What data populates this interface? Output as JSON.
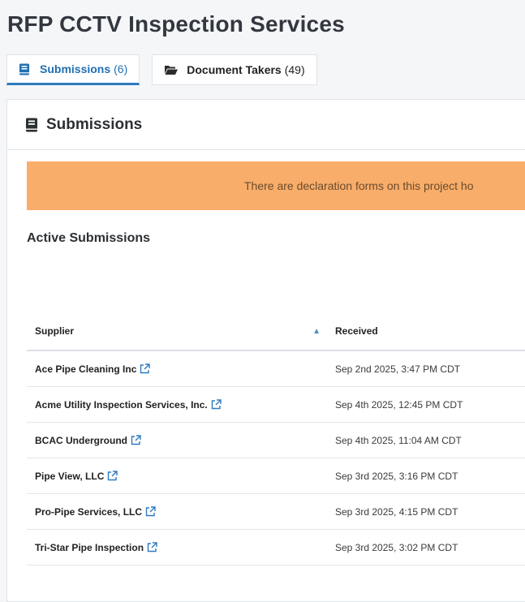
{
  "page": {
    "title": "RFP CCTV Inspection Services"
  },
  "tabs": [
    {
      "label": "Submissions",
      "count": "(6)",
      "icon": "book-icon",
      "active": true
    },
    {
      "label": "Document Takers",
      "count": "(49)",
      "icon": "folder-open-icon",
      "active": false
    }
  ],
  "panel": {
    "title": "Submissions",
    "icon": "book-icon",
    "alert": "There are declaration forms on this project ho",
    "section_heading": "Active Submissions"
  },
  "table": {
    "columns": [
      "Supplier",
      "Received"
    ],
    "sort_indicator": "▲",
    "rows": [
      {
        "supplier": "Ace Pipe Cleaning Inc",
        "received": "Sep 2nd 2025, 3:47 PM CDT"
      },
      {
        "supplier": "Acme Utility Inspection Services, Inc.",
        "received": "Sep 4th 2025, 12:45 PM CDT"
      },
      {
        "supplier": "BCAC Underground",
        "received": "Sep 4th 2025, 11:04 AM CDT"
      },
      {
        "supplier": "Pipe View, LLC",
        "received": "Sep 3rd 2025, 3:16 PM CDT"
      },
      {
        "supplier": "Pro-Pipe Services, LLC",
        "received": "Sep 3rd 2025, 4:15 PM CDT"
      },
      {
        "supplier": "Tri-Star Pipe Inspection",
        "received": "Sep 3rd 2025, 3:02 PM CDT"
      }
    ]
  },
  "colors": {
    "accent": "#2f7bbf",
    "alert_bg": "#f8ad6a",
    "sort_arrow": "#4a90c9"
  }
}
